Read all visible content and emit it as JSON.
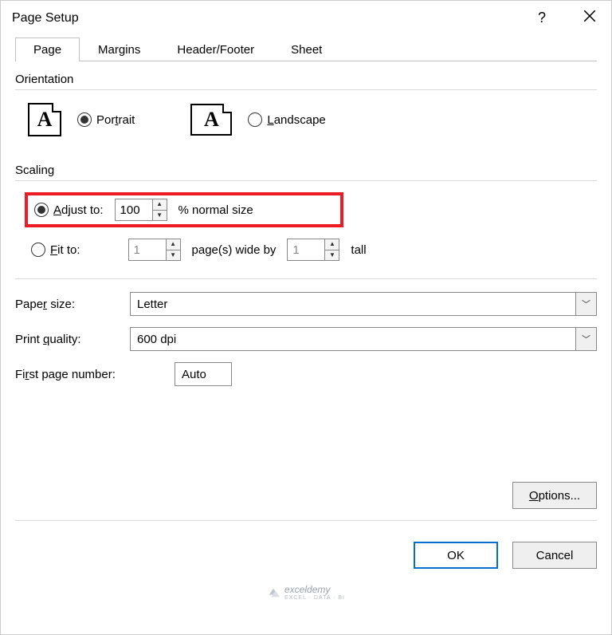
{
  "window": {
    "title": "Page Setup",
    "help": "?",
    "close": "✕"
  },
  "tabs": {
    "page": "Page",
    "margins": "Margins",
    "headerfooter": "Header/Footer",
    "sheet": "Sheet"
  },
  "orientation": {
    "group_label": "Orientation",
    "portrait_icon_letter": "A",
    "landscape_icon_letter": "A",
    "portrait_label_pre": "Por",
    "portrait_label_u": "t",
    "portrait_label_post": "rait",
    "landscape_label_u": "L",
    "landscape_label_post": "andscape"
  },
  "scaling": {
    "group_label": "Scaling",
    "adjust_label_u": "A",
    "adjust_label_post": "djust to:",
    "adjust_value": "100",
    "adjust_suffix": "% normal size",
    "fit_label_u": "F",
    "fit_label_post": "it to:",
    "fit_wide_value": "1",
    "fit_mid": "page(s) wide by",
    "fit_tall_value": "1",
    "fit_tall_suffix": "tall"
  },
  "paper": {
    "size_label_pre": "Pape",
    "size_label_u": "r",
    "size_label_post": " size:",
    "size_value": "Letter",
    "quality_label_pre": "Print ",
    "quality_label_u": "q",
    "quality_label_post": "uality:",
    "quality_value": "600 dpi"
  },
  "firstpage": {
    "label_pre": "Fi",
    "label_u": "r",
    "label_post": "st page number:",
    "value": "Auto"
  },
  "buttons": {
    "options_u": "O",
    "options_post": "ptions...",
    "ok": "OK",
    "cancel": "Cancel"
  },
  "watermark": {
    "brand": "exceldemy",
    "sub": "EXCEL · DATA · BI"
  }
}
